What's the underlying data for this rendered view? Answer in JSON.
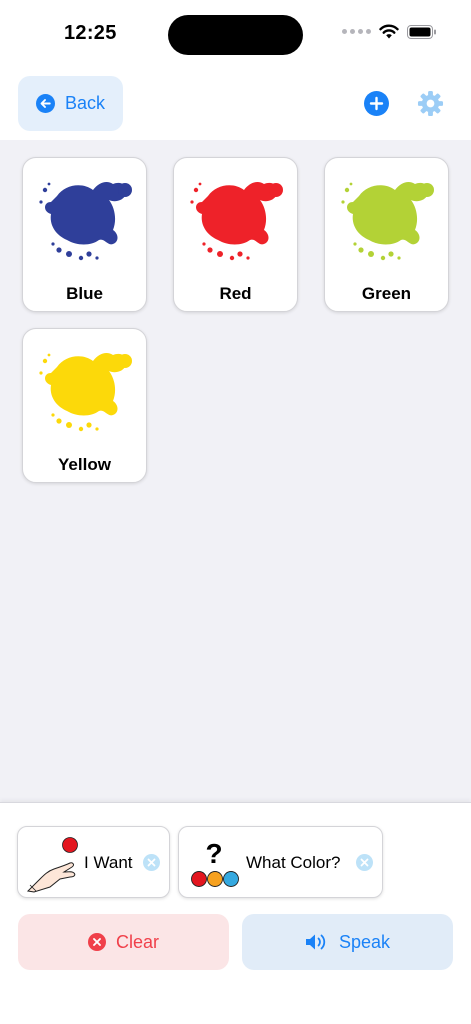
{
  "status_bar": {
    "time": "12:25"
  },
  "header": {
    "back_label": "Back"
  },
  "tiles": [
    {
      "label": "Blue",
      "color": "#2f3f9a"
    },
    {
      "label": "Red",
      "color": "#ee2229"
    },
    {
      "label": "Green",
      "color": "#b3d236"
    },
    {
      "label": "Yellow",
      "color": "#fcd90a"
    }
  ],
  "sentence_strip": {
    "chips": [
      {
        "label": "I Want"
      },
      {
        "label": "What Color?"
      }
    ]
  },
  "actions": {
    "clear_label": "Clear",
    "speak_label": "Speak"
  },
  "colors": {
    "accent": "#1a82f7",
    "danger": "#f0404a",
    "background": "#f1f1f6"
  }
}
